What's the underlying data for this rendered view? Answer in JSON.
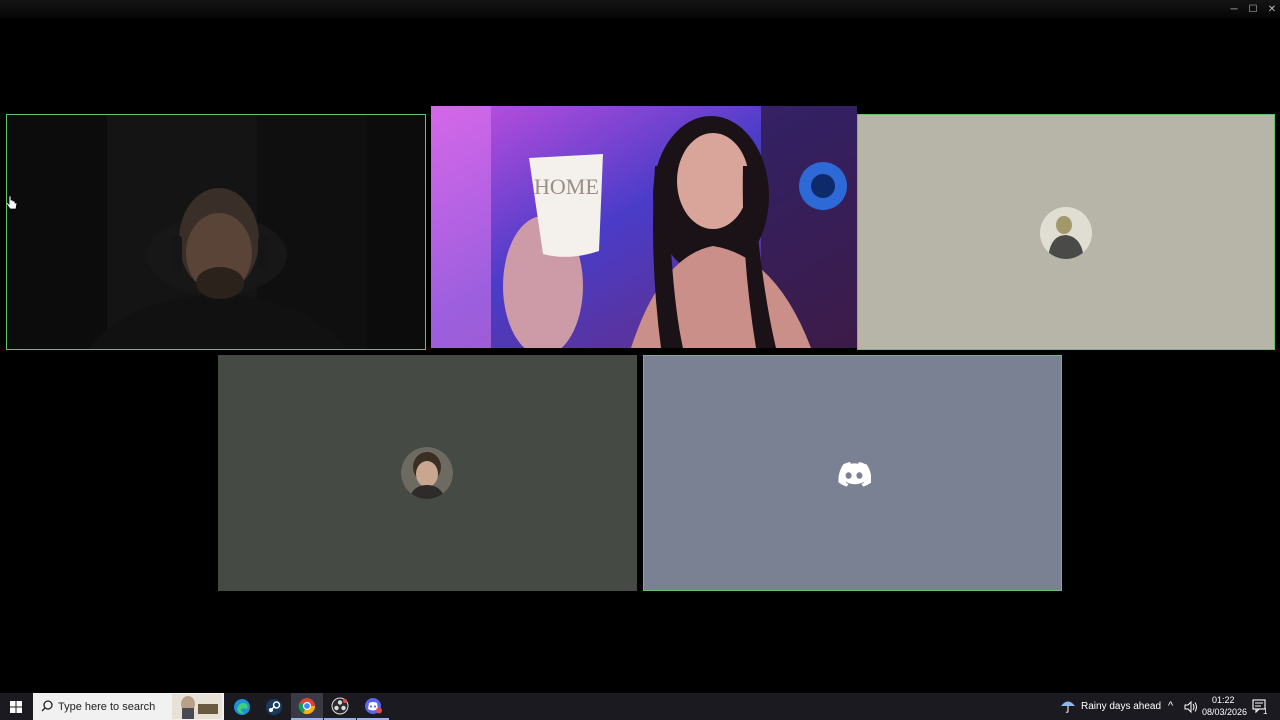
{
  "window": {
    "controls": {
      "minimize": "─",
      "maximize": "☐",
      "close": "✕"
    }
  },
  "tiles": [
    {
      "kind": "video",
      "content": "man-dim-room",
      "speaking": true
    },
    {
      "kind": "video",
      "content": "woman-drinking-from-HOME-mug",
      "mug_text": "HOME",
      "speaking": false
    },
    {
      "kind": "avatar",
      "background": "#b7b5a8",
      "speaking": true
    },
    {
      "kind": "avatar",
      "background": "#464a44",
      "speaking": false
    },
    {
      "kind": "discord-logo",
      "background": "#7a8192",
      "speaking": true
    }
  ],
  "taskbar": {
    "search_placeholder": "Type here to search",
    "apps": [
      "edge-icon",
      "steam-icon",
      "chrome-icon",
      "obs-icon",
      "discord-icon"
    ],
    "weather": "Rainy days ahead",
    "time": "01:22",
    "date": "08/03/2026",
    "notification_count": "1"
  },
  "colors": {
    "speaking_border": "#63c46f",
    "taskbar": "#1b1a21"
  }
}
